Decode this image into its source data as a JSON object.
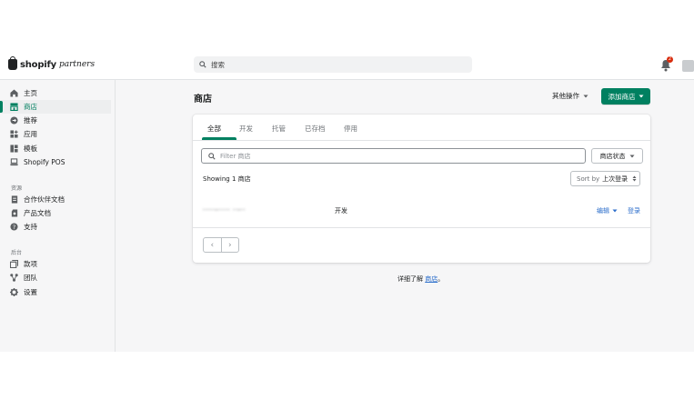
{
  "brand": {
    "name": "shopify",
    "suffix": "partners"
  },
  "search": {
    "placeholder": "搜索"
  },
  "notifications": {
    "count": "2"
  },
  "sidebar": {
    "items": [
      {
        "label": "主页",
        "icon": "home-icon"
      },
      {
        "label": "商店",
        "icon": "store-icon",
        "active": true
      },
      {
        "label": "推荐",
        "icon": "referral-icon"
      },
      {
        "label": "应用",
        "icon": "apps-icon"
      },
      {
        "label": "模板",
        "icon": "themes-icon"
      },
      {
        "label": "Shopify POS",
        "icon": "pos-icon"
      }
    ],
    "resources_heading": "资源",
    "resources": [
      {
        "label": "合作伙伴文档",
        "icon": "document-icon"
      },
      {
        "label": "产品文档",
        "icon": "product-doc-icon"
      },
      {
        "label": "支持",
        "icon": "help-icon"
      }
    ],
    "backend_heading": "后台",
    "backend": [
      {
        "label": "款项",
        "icon": "payouts-icon"
      },
      {
        "label": "团队",
        "icon": "team-icon"
      },
      {
        "label": "设置",
        "icon": "gear-icon"
      }
    ]
  },
  "page": {
    "title": "商店",
    "more_actions": "其他操作",
    "add_store": "添加商店"
  },
  "tabs": [
    "全部",
    "开发",
    "托管",
    "已存档",
    "停用"
  ],
  "filter": {
    "placeholder": "Filter 商店",
    "status_button": "商店状态"
  },
  "list": {
    "showing": "Showing 1 商店",
    "sort_label": "Sort by",
    "sort_value": "上次登录",
    "rows": [
      {
        "name": "·····-····· ··-··",
        "type": "开发",
        "edit": "编辑",
        "login": "登录"
      }
    ]
  },
  "footer": {
    "learn_prefix": "详细了解",
    "learn_link": "商店",
    "learn_suffix": "。"
  },
  "colors": {
    "accent": "#008060",
    "link": "#2c6ecb",
    "badge": "#d82c0d"
  }
}
